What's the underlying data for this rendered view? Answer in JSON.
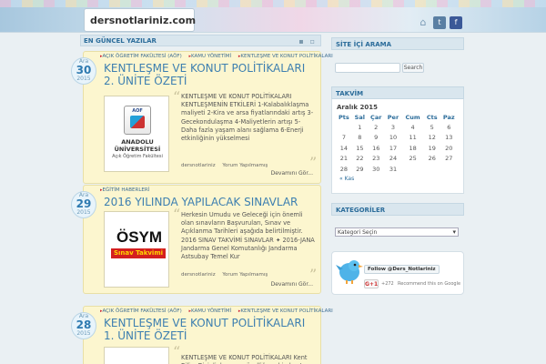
{
  "site": {
    "logo": "dersnotlariniz.com"
  },
  "main": {
    "header": "EN GÜNCEL YAZILAR",
    "view_icons": "▪ ▫"
  },
  "posts": [
    {
      "date": {
        "month": "Ara",
        "day": "30",
        "year": "2015"
      },
      "categories": [
        "AÇIK ÖĞRETİM FAKÜLTESİ (AÖF)",
        "KAMU YÖNETİMİ",
        "KENTLEŞME VE KONUT POLİTİKALARI"
      ],
      "title": "KENTLEŞME VE KONUT POLİTİKALARI 2. ÜNİTE ÖZETİ",
      "thumb": {
        "line1": "AOF",
        "line2": "ANADOLU",
        "line3": "ÜNİVERSİTESİ",
        "line4": "Açık Öğretim Fakültesi"
      },
      "excerpt": "KENTLEŞME VE KONUT POLİTİKALARI KENTLEŞMENİN ETKİLERİ 1-Kalabalıklaşma maliyeti 2-Kira ve arsa fiyatlarındaki artış 3-Gecekondulaşma 4-Maliyetlerin artışı 5-Daha fazla yaşam alanı sağlama 6-Enerji etkinliğinin yükselmesi",
      "author": "dersnotlariniz",
      "comments": "Yorum Yapılmamış",
      "more": "Devamını Gör..."
    },
    {
      "date": {
        "month": "Ara",
        "day": "29",
        "year": "2015"
      },
      "categories": [
        "EĞİTİM HABERLERİ"
      ],
      "title": "2016 YILINDA YAPILACAK SINAVLAR",
      "thumb": {
        "line1": "ÖSYM",
        "line2": "Sınav Takvimi"
      },
      "excerpt": "Herkesin Umudu ve Geleceği için önemli olan sınavların Başvuruları, Sınav ve Açıklanma Tarihleri aşağıda belirtilmiştir. 2016 SINAV TAKVİMİ SINAVLAR ✦ 2016-JANA Jandarma Genel Komutanlığı Jandarma Astsubay Temel Kur",
      "author": "dersnotlariniz",
      "comments": "Yorum Yapılmamış",
      "more": "Devamını Gör..."
    },
    {
      "date": {
        "month": "Ara",
        "day": "28",
        "year": "2015"
      },
      "categories": [
        "AÇIK ÖĞRETİM FAKÜLTESİ (AÖF)",
        "KAMU YÖNETİMİ",
        "KENTLEŞME VE KONUT POLİTİKALARI"
      ],
      "title": "KENTLEŞME VE KONUT POLİTİKALARI 1. ÜNİTE ÖZETİ",
      "excerpt": "KENTLEŞME VE KONUT POLİTİKALARI Kent Bilim:Disiplinler arası özelliğe sahip kent ve"
    }
  ],
  "sidebar": {
    "search": {
      "title": "SİTE İÇİ ARAMA",
      "placeholder": "",
      "button": "Search"
    },
    "calendar": {
      "title": "TAKVİM",
      "caption": "Aralık 2015",
      "headers": [
        "Pts",
        "Sal",
        "Çar",
        "Per",
        "Cum",
        "Cts",
        "Paz"
      ],
      "rows": [
        [
          "",
          "1",
          "2",
          "3",
          "4",
          "5",
          "6"
        ],
        [
          "7",
          "8",
          "9",
          "10",
          "11",
          "12",
          "13"
        ],
        [
          "14",
          "15",
          "16",
          "17",
          "18",
          "19",
          "20"
        ],
        [
          "21",
          "22",
          "23",
          "24",
          "25",
          "26",
          "27"
        ],
        [
          "28",
          "29",
          "30",
          "31",
          "",
          "",
          ""
        ]
      ],
      "prev": "« Kas"
    },
    "categories": {
      "title": "KATEGORİLER",
      "selected": "Kategori Seçin"
    },
    "social": {
      "follow": "Follow @Ders_Notlariniz",
      "gplus": "G+1",
      "count": "+272",
      "recommend": "Recommend this on Google"
    }
  }
}
